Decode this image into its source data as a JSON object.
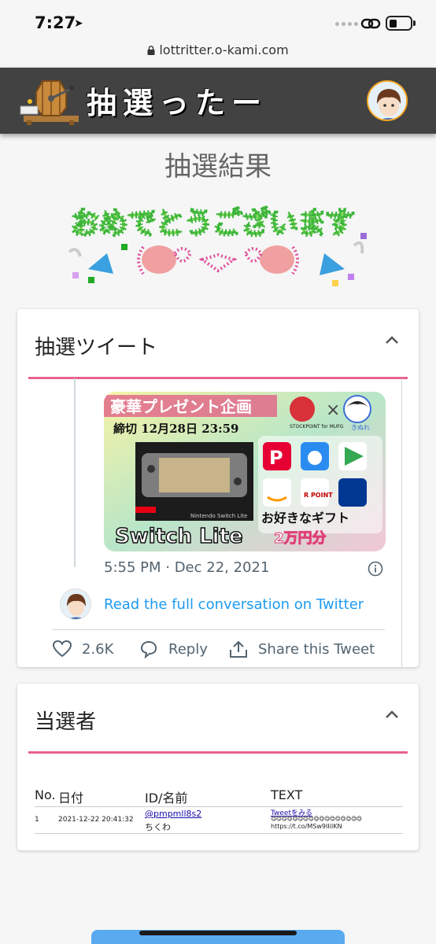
{
  "status_bar": {
    "time": "7:27",
    "location_icon": "location-arrow-icon",
    "link_icon": "link-icon",
    "battery_icon": "battery-icon"
  },
  "browser": {
    "url": "lottritter.o-kami.com",
    "lock_icon": "lock-icon"
  },
  "header": {
    "site_title": "抽選ったー",
    "logo": "lottery-machine-logo",
    "avatar": "user-avatar"
  },
  "page": {
    "title": "抽選結果",
    "congrats_text": "おめでとうございます"
  },
  "tweet_section": {
    "title": "抽選ツイート",
    "image_text": {
      "headline": "豪華プレゼント企画",
      "deadline": "締切 12月28日 23:59",
      "stockpoint": "STOCKPOINT for MUFG",
      "sponsor": "きぬれ",
      "product": "Switch Lite",
      "gift": "お好きなギフト",
      "amount": "2万円分",
      "rpoint": "R POINT",
      "console_label": "Nintendo Switch Lite"
    },
    "date": "5:55 PM · Dec 22, 2021",
    "read_link": "Read the full conversation on Twitter",
    "likes": "2.6K",
    "reply_label": "Reply",
    "share_label": "Share this Tweet"
  },
  "winners_section": {
    "title": "当選者",
    "columns": [
      "No.",
      "日付",
      "ID/名前",
      "TEXT"
    ],
    "rows": [
      {
        "no": "1",
        "date": "2021-12-22 20:41:32",
        "id": "@pmpmll8s2",
        "name": "ちくわ",
        "tweet_link": "Tweetをみる",
        "text_emoji": "😋😋😋😋😋😋😋😋😋😋😋😋😋😋😋😋😋",
        "url": "https://t.co/MSw9IIiIKN"
      }
    ]
  },
  "colors": {
    "header_bg": "#424242",
    "accent_line": "#e8638c",
    "link": "#1d9bf0"
  }
}
